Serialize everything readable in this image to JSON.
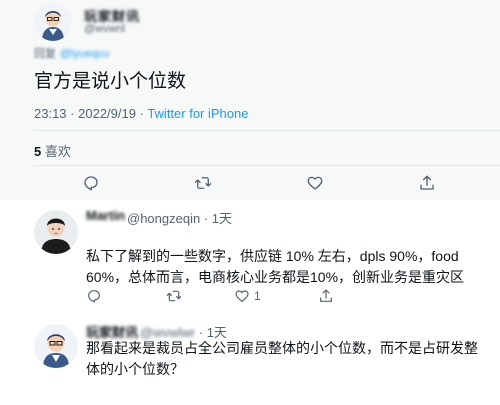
{
  "main_tweet": {
    "author_name": "玩家财讯",
    "author_handle": "@wvwnl",
    "reply_to_label": "回复",
    "reply_to_handle": "@lyueqcu",
    "text": "官方是说小个位数",
    "time": "23:13",
    "date": "2022/9/19",
    "source": "Twitter for iPhone",
    "likes_count": "5",
    "likes_label": "喜欢"
  },
  "replies": [
    {
      "author_name": "Martin",
      "author_handle": "@hongzeqin",
      "time_ago": "1天",
      "text": "私下了解到的一些数字，供应链 10% 左右，dpls 90%，food 60%，总体而言，电商核心业务都是10%，创新业务是重灾区",
      "comment_count": "",
      "like_count": "1"
    },
    {
      "author_name": "玩家财讯",
      "author_handle": "@wvwlwr",
      "time_ago": "1天",
      "text": "那看起来是裁员占全公司雇员整体的小个位数，而不是占研发整体的小个位数？"
    }
  ],
  "colors": {
    "accent": "#1d9bf0",
    "secondary_text": "#536471",
    "main_background": "#f7f9f9"
  },
  "icons": [
    "reply-icon",
    "retweet-icon",
    "like-icon",
    "share-icon"
  ]
}
